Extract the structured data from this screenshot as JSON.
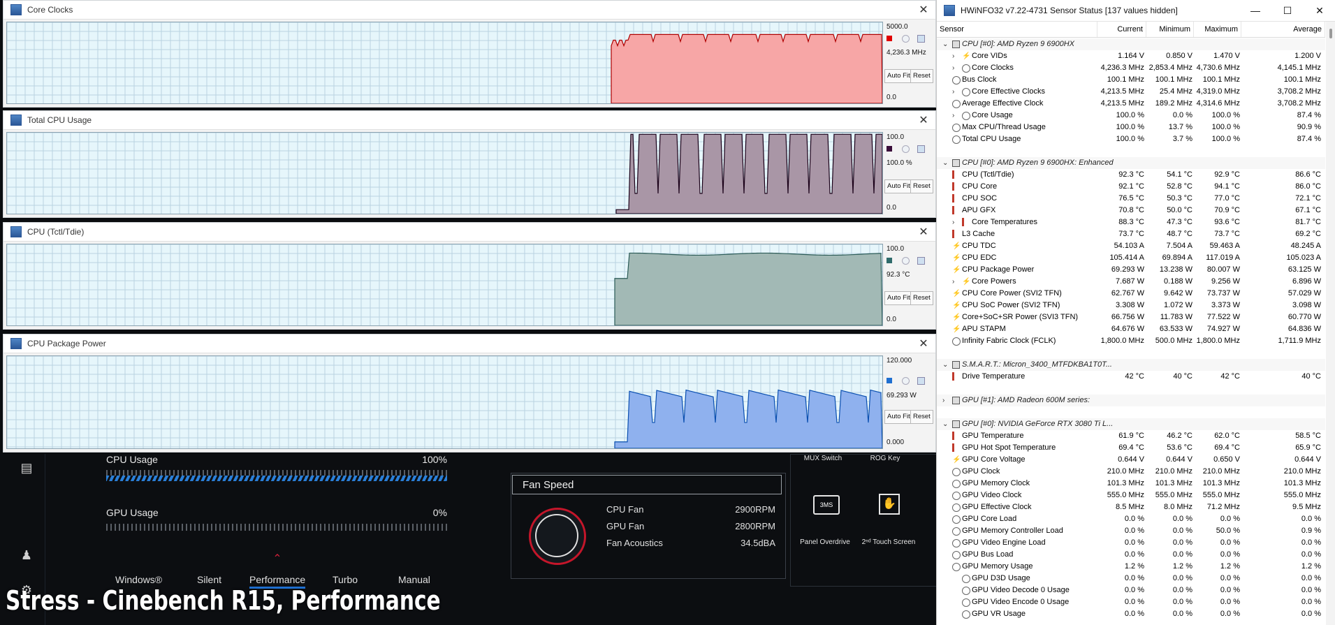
{
  "caption": "Stress - Cinebench R15, Performance",
  "graphs": [
    {
      "title": "Core Clocks",
      "max": "5000.0",
      "min": "0.0",
      "current": "4,236.3 MHz",
      "swatch": "#e00000",
      "fill": "#f7a6a6",
      "stroke": "#b00000",
      "autofit": "Auto Fit",
      "reset": "Reset"
    },
    {
      "title": "Total CPU Usage",
      "max": "100.0",
      "min": "0.0",
      "current": "100.0 %",
      "swatch": "#3a0e3a",
      "fill": "#a996a6",
      "stroke": "#1a0018",
      "autofit": "Auto Fit",
      "reset": "Reset"
    },
    {
      "title": "CPU (Tctl/Tdie)",
      "max": "100.0",
      "min": "0.0",
      "current": "92.3 °C",
      "swatch": "#2f6b6b",
      "fill": "#a2b9b5",
      "stroke": "#2a5a56",
      "autofit": "Auto Fit",
      "reset": "Reset"
    },
    {
      "title": "CPU Package Power",
      "max": "120.000",
      "min": "0.000",
      "current": "69.293 W",
      "swatch": "#1f6fd0",
      "fill": "#8fb1ee",
      "stroke": "#0a4fb0",
      "autofit": "Auto Fit",
      "reset": "Reset"
    }
  ],
  "armoury": {
    "cpu_usage_label": "CPU Usage",
    "cpu_usage_value": "100%",
    "cpu_usage_level": 1.0,
    "gpu_usage_label": "GPU Usage",
    "gpu_usage_value": "0%",
    "gpu_usage_level": 0.0,
    "modes": [
      "Windows®",
      "Silent",
      "Performance",
      "Turbo",
      "Manual"
    ],
    "active_mode": "Performance",
    "fan_title": "Fan Speed",
    "fans": [
      {
        "label": "CPU Fan",
        "value": "2900RPM"
      },
      {
        "label": "GPU Fan",
        "value": "2800RPM"
      },
      {
        "label": "Fan Acoustics",
        "value": "34.5dBA"
      }
    ],
    "tiles": [
      "MUX Switch",
      "ROG Key",
      "Panel Overdrive",
      "2ⁿᵈ Touch Screen"
    ]
  },
  "hwinfo": {
    "title": "HWiNFO32 v7.22-4731 Sensor Status [137 values hidden]",
    "columns": [
      "Sensor",
      "Current",
      "Minimum",
      "Maximum",
      "Average"
    ],
    "rows": [
      {
        "type": "group",
        "name": "CPU [#0]: AMD Ryzen 9 6900HX"
      },
      {
        "type": "sub",
        "icon": "bolt",
        "name": "Core VIDs",
        "cur": "1.164 V",
        "min": "0.850 V",
        "max": "1.470 V",
        "avg": "1.200 V"
      },
      {
        "type": "sub",
        "icon": "clock",
        "name": "Core Clocks",
        "cur": "4,236.3 MHz",
        "min": "2,853.4 MHz",
        "max": "4,730.6 MHz",
        "avg": "4,145.1 MHz"
      },
      {
        "type": "item",
        "icon": "clock",
        "name": "Bus Clock",
        "cur": "100.1 MHz",
        "min": "100.1 MHz",
        "max": "100.1 MHz",
        "avg": "100.1 MHz"
      },
      {
        "type": "sub",
        "icon": "clock",
        "name": "Core Effective Clocks",
        "cur": "4,213.5 MHz",
        "min": "25.4 MHz",
        "max": "4,319.0 MHz",
        "avg": "3,708.2 MHz"
      },
      {
        "type": "item",
        "icon": "clock",
        "name": "Average Effective Clock",
        "cur": "4,213.5 MHz",
        "min": "189.2 MHz",
        "max": "4,314.6 MHz",
        "avg": "3,708.2 MHz"
      },
      {
        "type": "sub",
        "icon": "clock",
        "name": "Core Usage",
        "cur": "100.0 %",
        "min": "0.0 %",
        "max": "100.0 %",
        "avg": "87.4 %"
      },
      {
        "type": "item",
        "icon": "clock",
        "name": "Max CPU/Thread Usage",
        "cur": "100.0 %",
        "min": "13.7 %",
        "max": "100.0 %",
        "avg": "90.9 %"
      },
      {
        "type": "item",
        "icon": "clock",
        "name": "Total CPU Usage",
        "cur": "100.0 %",
        "min": "3.7 %",
        "max": "100.0 %",
        "avg": "87.4 %"
      },
      {
        "type": "blank"
      },
      {
        "type": "group",
        "name": "CPU [#0]: AMD Ryzen 9 6900HX: Enhanced"
      },
      {
        "type": "item",
        "icon": "therm",
        "name": "CPU (Tctl/Tdie)",
        "cur": "92.3 °C",
        "min": "54.1 °C",
        "max": "92.9 °C",
        "avg": "86.6 °C"
      },
      {
        "type": "item",
        "icon": "therm",
        "name": "CPU Core",
        "cur": "92.1 °C",
        "min": "52.8 °C",
        "max": "94.1 °C",
        "avg": "86.0 °C"
      },
      {
        "type": "item",
        "icon": "therm",
        "name": "CPU SOC",
        "cur": "76.5 °C",
        "min": "50.3 °C",
        "max": "77.0 °C",
        "avg": "72.1 °C"
      },
      {
        "type": "item",
        "icon": "therm",
        "name": "APU GFX",
        "cur": "70.8 °C",
        "min": "50.0 °C",
        "max": "70.9 °C",
        "avg": "67.1 °C"
      },
      {
        "type": "sub",
        "icon": "therm",
        "name": "Core Temperatures",
        "cur": "88.3 °C",
        "min": "47.3 °C",
        "max": "93.6 °C",
        "avg": "81.7 °C"
      },
      {
        "type": "item",
        "icon": "therm",
        "name": "L3 Cache",
        "cur": "73.7 °C",
        "min": "48.7 °C",
        "max": "73.7 °C",
        "avg": "69.2 °C"
      },
      {
        "type": "item",
        "icon": "bolt",
        "name": "CPU TDC",
        "cur": "54.103 A",
        "min": "7.504 A",
        "max": "59.463 A",
        "avg": "48.245 A"
      },
      {
        "type": "item",
        "icon": "bolt",
        "name": "CPU EDC",
        "cur": "105.414 A",
        "min": "69.894 A",
        "max": "117.019 A",
        "avg": "105.023 A"
      },
      {
        "type": "item",
        "icon": "bolt",
        "name": "CPU Package Power",
        "cur": "69.293 W",
        "min": "13.238 W",
        "max": "80.007 W",
        "avg": "63.125 W"
      },
      {
        "type": "sub",
        "icon": "bolt",
        "name": "Core Powers",
        "cur": "7.687 W",
        "min": "0.188 W",
        "max": "9.256 W",
        "avg": "6.896 W"
      },
      {
        "type": "item",
        "icon": "bolt",
        "name": "CPU Core Power (SVI2 TFN)",
        "cur": "62.767 W",
        "min": "9.642 W",
        "max": "73.737 W",
        "avg": "57.029 W"
      },
      {
        "type": "item",
        "icon": "bolt",
        "name": "CPU SoC Power (SVI2 TFN)",
        "cur": "3.308 W",
        "min": "1.072 W",
        "max": "3.373 W",
        "avg": "3.098 W"
      },
      {
        "type": "item",
        "icon": "bolt",
        "name": "Core+SoC+SR Power (SVI3 TFN)",
        "cur": "66.756 W",
        "min": "11.783 W",
        "max": "77.522 W",
        "avg": "60.770 W"
      },
      {
        "type": "item",
        "icon": "bolt",
        "name": "APU STAPM",
        "cur": "64.676 W",
        "min": "63.533 W",
        "max": "74.927 W",
        "avg": "64.836 W"
      },
      {
        "type": "item",
        "icon": "clock",
        "name": "Infinity Fabric Clock (FCLK)",
        "cur": "1,800.0 MHz",
        "min": "500.0 MHz",
        "max": "1,800.0 MHz",
        "avg": "1,711.9 MHz"
      },
      {
        "type": "blank"
      },
      {
        "type": "group",
        "name": "S.M.A.R.T.: Micron_3400_MTFDKBA1T0T..."
      },
      {
        "type": "item",
        "icon": "therm",
        "name": "Drive Temperature",
        "cur": "42 °C",
        "min": "40 °C",
        "max": "42 °C",
        "avg": "40 °C"
      },
      {
        "type": "blank"
      },
      {
        "type": "groupc",
        "name": "GPU [#1]: AMD Radeon 600M series:"
      },
      {
        "type": "blank"
      },
      {
        "type": "group",
        "name": "GPU [#0]: NVIDIA GeForce RTX 3080 Ti L..."
      },
      {
        "type": "item",
        "icon": "therm",
        "name": "GPU Temperature",
        "cur": "61.9 °C",
        "min": "46.2 °C",
        "max": "62.0 °C",
        "avg": "58.5 °C"
      },
      {
        "type": "item",
        "icon": "therm",
        "name": "GPU Hot Spot Temperature",
        "cur": "69.4 °C",
        "min": "53.6 °C",
        "max": "69.4 °C",
        "avg": "65.9 °C"
      },
      {
        "type": "item",
        "icon": "bolt",
        "name": "GPU Core Voltage",
        "cur": "0.644 V",
        "min": "0.644 V",
        "max": "0.650 V",
        "avg": "0.644 V"
      },
      {
        "type": "item",
        "icon": "clock",
        "name": "GPU Clock",
        "cur": "210.0 MHz",
        "min": "210.0 MHz",
        "max": "210.0 MHz",
        "avg": "210.0 MHz"
      },
      {
        "type": "item",
        "icon": "clock",
        "name": "GPU Memory Clock",
        "cur": "101.3 MHz",
        "min": "101.3 MHz",
        "max": "101.3 MHz",
        "avg": "101.3 MHz"
      },
      {
        "type": "item",
        "icon": "clock",
        "name": "GPU Video Clock",
        "cur": "555.0 MHz",
        "min": "555.0 MHz",
        "max": "555.0 MHz",
        "avg": "555.0 MHz"
      },
      {
        "type": "item",
        "icon": "clock",
        "name": "GPU Effective Clock",
        "cur": "8.5 MHz",
        "min": "8.0 MHz",
        "max": "71.2 MHz",
        "avg": "9.5 MHz"
      },
      {
        "type": "item",
        "icon": "clock",
        "name": "GPU Core Load",
        "cur": "0.0 %",
        "min": "0.0 %",
        "max": "0.0 %",
        "avg": "0.0 %"
      },
      {
        "type": "item",
        "icon": "clock",
        "name": "GPU Memory Controller Load",
        "cur": "0.0 %",
        "min": "0.0 %",
        "max": "50.0 %",
        "avg": "0.9 %"
      },
      {
        "type": "item",
        "icon": "clock",
        "name": "GPU Video Engine Load",
        "cur": "0.0 %",
        "min": "0.0 %",
        "max": "0.0 %",
        "avg": "0.0 %"
      },
      {
        "type": "item",
        "icon": "clock",
        "name": "GPU Bus Load",
        "cur": "0.0 %",
        "min": "0.0 %",
        "max": "0.0 %",
        "avg": "0.0 %"
      },
      {
        "type": "item",
        "icon": "clock",
        "name": "GPU Memory Usage",
        "cur": "1.2 %",
        "min": "1.2 %",
        "max": "1.2 %",
        "avg": "1.2 %"
      },
      {
        "type": "item2",
        "icon": "clock",
        "name": "GPU D3D Usage",
        "cur": "0.0 %",
        "min": "0.0 %",
        "max": "0.0 %",
        "avg": "0.0 %"
      },
      {
        "type": "item2",
        "icon": "clock",
        "name": "GPU Video Decode 0 Usage",
        "cur": "0.0 %",
        "min": "0.0 %",
        "max": "0.0 %",
        "avg": "0.0 %"
      },
      {
        "type": "item2",
        "icon": "clock",
        "name": "GPU Video Encode 0 Usage",
        "cur": "0.0 %",
        "min": "0.0 %",
        "max": "0.0 %",
        "avg": "0.0 %"
      },
      {
        "type": "item2",
        "icon": "clock",
        "name": "GPU VR Usage",
        "cur": "0.0 %",
        "min": "0.0 %",
        "max": "0.0 %",
        "avg": "0.0 %"
      }
    ]
  }
}
